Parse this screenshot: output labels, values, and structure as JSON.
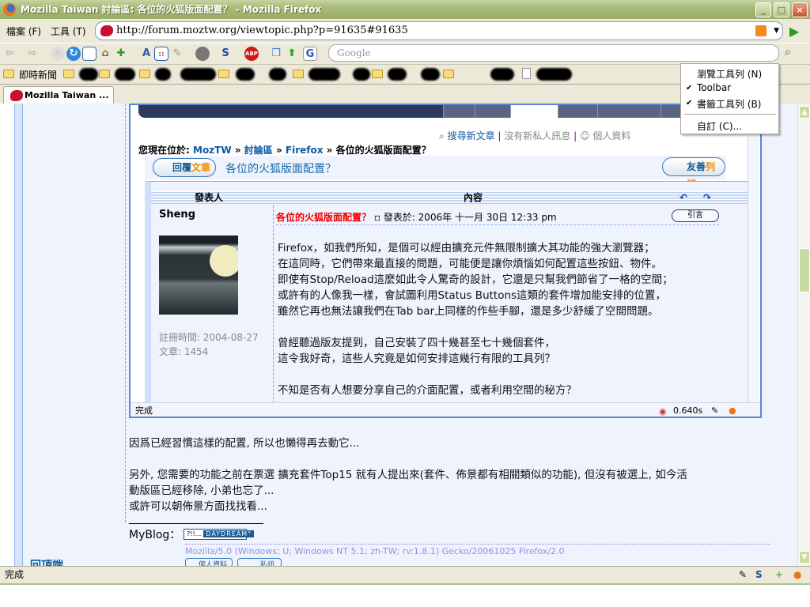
{
  "window": {
    "title": "Mozilla Taiwan 討論區: 各位的火狐版面配置？ - Mozilla Firefox",
    "min": "_",
    "max": "□",
    "close": "×"
  },
  "menu": {
    "file": "檔案 (F)",
    "tools": "工具 (T)"
  },
  "url": "http://forum.moztw.org/viewtopic.php?p=91635#91635",
  "search": {
    "placeholder": "Google"
  },
  "toolbar_icons": [
    "back",
    "forward",
    "stop",
    "reload",
    "sidebar",
    "home",
    "extensions",
    "text-size",
    "screen-grab",
    "tool",
    "globe",
    "stumble-s",
    "adblock-plus",
    "copy",
    "up-arrow",
    "google-g"
  ],
  "bookmarks": {
    "first": "即時新聞"
  },
  "tab": {
    "label": "Mozilla Taiwan ..."
  },
  "context_menu": {
    "items": [
      {
        "label": "瀏覽工具列 (N)",
        "checked": false
      },
      {
        "label": "Toolbar",
        "checked": true
      },
      {
        "label": "書籤工具列 (B)",
        "checked": true
      },
      {
        "label": "自訂 (C)...",
        "checked": false
      }
    ]
  },
  "inner": {
    "links": {
      "search": "搜尋新文章",
      "pm": "沒有新私人訊息",
      "profile": "個人資料",
      "sep": "|"
    },
    "breadcrumb": {
      "prefix": "您現在位於:",
      "home": "MozTW",
      "forum": "討論區",
      "sub": "Firefox",
      "topic": "各位的火狐版面配置？",
      "sep": "»"
    },
    "reply_btn": {
      "a": "回覆",
      "b": "文章"
    },
    "topic_title": "各位的火狐版面配置？",
    "print_btn": {
      "a": "友善",
      "b": "列印"
    },
    "headers": {
      "author": "發表人",
      "content": "內容"
    },
    "post": {
      "author": "Sheng",
      "title": "各位的火狐版面配置？",
      "posted": "發表於: 2006年 十一月 30日 12:33 pm",
      "quote": "引言",
      "registered": "註冊時間: 2004-08-27",
      "posts": "文章: 1454",
      "body": "Firefox，如我們所知，是個可以經由擴充元件無限制擴大其功能的強大瀏覽器；\n在這同時，它們帶來最直接的問題，可能便是讓你煩惱如何配置這些按鈕、物件。\n即使有Stop/Reload這麼如此令人驚奇的設計，它還是只幫我們節省了一格的空間；\n或許有的人像我一樣，會試圖利用Status Buttons這類的套件增加能安排的位置，\n雖然它再也無法讓我們在Tab bar上同樣的作些手腳，還是多少舒緩了空間問題。\n\n曾經聽過版友提到，自己安裝了四十幾甚至七十幾個套件，\n這令我好奇，這些人究竟是如何安排這幾行有限的工具列？\n\n不知是否有人想要分享自己的介面配置，或者利用空間的秘方？"
    },
    "status": "完成",
    "timer": "0.640s"
  },
  "reply": {
    "text": "因爲已經習慣這樣的配置, 所以也懶得再去動它...\n\n另外, 您需要的功能之前在票選 擴充套件Top15 就有人提出來(套件、佈景都有相關類似的功能), 但沒有被選上, 如今活\n動版區已經移除, 小弟也忘了...\n或許可以朝佈景方面找找看..."
  },
  "signature": {
    "label": "MyBlog：",
    "badge_a": "?!!...",
    "badge_b": "DAYDREAM°",
    "ua": "Mozilla/5.0 (Windows; U; Windows NT 5.1; zh-TW; rv:1.8.1) Gecko/20061025 Firefox/2.0"
  },
  "post_buttons": {
    "profile": "個人資料",
    "pm": "私訊"
  },
  "totop": "回頂端",
  "status": "完成",
  "colors": {
    "accent": "#0a5aa3",
    "title_red": "#ee0000",
    "page_bg": "#eef3fd"
  }
}
